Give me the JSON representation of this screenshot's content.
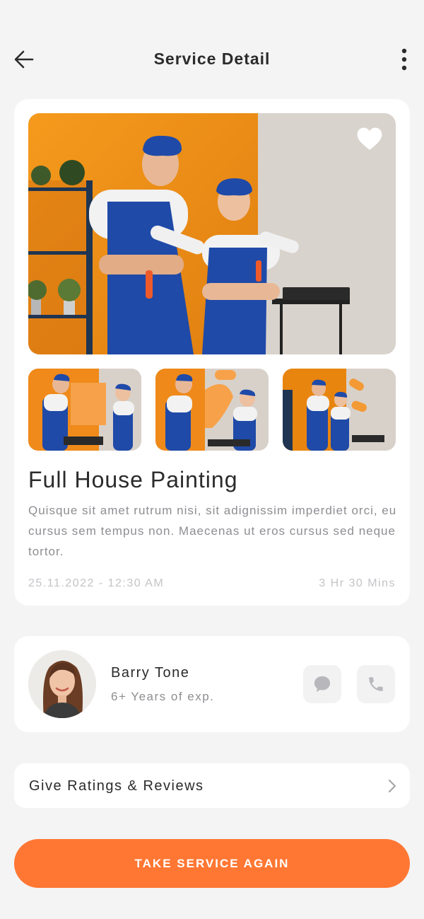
{
  "header": {
    "title": "Service Detail",
    "back_icon": "arrow-left-icon",
    "more_icon": "more-vertical-icon"
  },
  "service": {
    "title": "Full House Painting",
    "description": "Quisque sit amet rutrum nisi, sit adignissim imperdiet orci, eu cursus sem tempus non. Maecenas ut eros cursus sed neque tortor.",
    "date": "25.11.2022 - 12:30 AM",
    "duration": "3 Hr 30 Mins",
    "favorite_icon": "heart-icon",
    "gallery": [
      "photo-painters-posing",
      "photo-painting-wall",
      "photo-roller-on-wall",
      "photo-painters-rollers"
    ]
  },
  "provider": {
    "name": "Barry Tone",
    "experience": "6+ Years of exp.",
    "chat_icon": "chat-bubble-icon",
    "call_icon": "phone-icon"
  },
  "ratings": {
    "label": "Give Ratings & Reviews",
    "icon": "chevron-right-icon"
  },
  "cta": {
    "label": "TAKE SERVICE AGAIN"
  },
  "colors": {
    "accent": "#ff7733",
    "background": "#f4f4f5",
    "card": "#ffffff",
    "muted_text": "#8e8e93"
  }
}
